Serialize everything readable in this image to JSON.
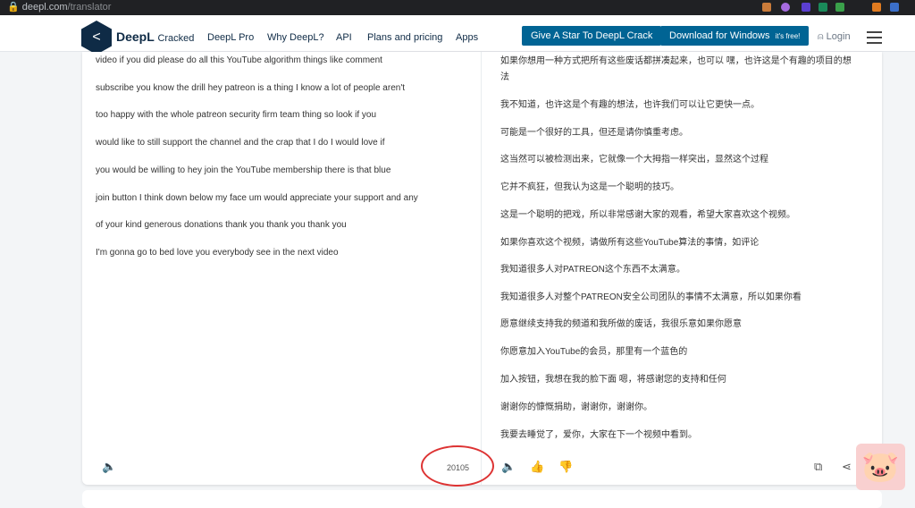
{
  "browser": {
    "domain": "deepl.com",
    "path": "/translator"
  },
  "header": {
    "brand": "DeepL",
    "brand_suffix": "Cracked",
    "nav": [
      "DeepL Pro",
      "Why DeepL?",
      "API",
      "Plans and pricing",
      "Apps"
    ],
    "star_button": "Give A Star To DeepL Crack",
    "download_button": "Download for Windows",
    "download_note": "it's free!",
    "login": "Login"
  },
  "source": {
    "lines": [
      "video if you did please do all this YouTube algorithm things like comment",
      "subscribe you know the drill hey patreon is a thing I know a lot of people aren't",
      "too happy with the whole patreon security firm team thing so look if you",
      "would like to still support the channel and the crap that I do I would love if",
      "you would be willing to hey join the YouTube membership there is that blue",
      "join button I think down below my face um would appreciate your support and any",
      "of your kind generous donations thank you thank you thank you",
      "I'm gonna go to bed love you everybody see in the next video"
    ],
    "char_count": "20105"
  },
  "target": {
    "lines": [
      "如果你想用一种方式把所有这些废话都拼凑起来，也可以 嘿，也许这是个有趣的项目的想",
      "法",
      "我不知道，也许这是个有趣的想法，也许我们可以让它更快一点。",
      "可能是一个很好的工具，但还是请你慎重考虑。",
      "这当然可以被检测出来，它就像一个大拇指一样突出，显然这个过程",
      "它并不疯狂，但我认为这是一个聪明的技巧。",
      "这是一个聪明的把戏，所以非常感谢大家的观看，希望大家喜欢这个视频。",
      "如果你喜欢这个视频，请做所有这些YouTube算法的事情，如评论",
      "我知道很多人对PATREON这个东西不太满意。",
      "我知道很多人对整个PATREON安全公司团队的事情不太满意，所以如果你看",
      "愿意继续支持我的频道和我所做的废话，我很乐意如果你愿意",
      "你愿意加入YouTube的会员，那里有一个蓝色的",
      "加入按钮，我想在我的脸下面 嗯，将感谢您的支持和任何",
      "谢谢你的慷慨捐助，谢谢你，谢谢你。",
      "我要去睡觉了，爱你，大家在下一个视频中看到。"
    ]
  }
}
